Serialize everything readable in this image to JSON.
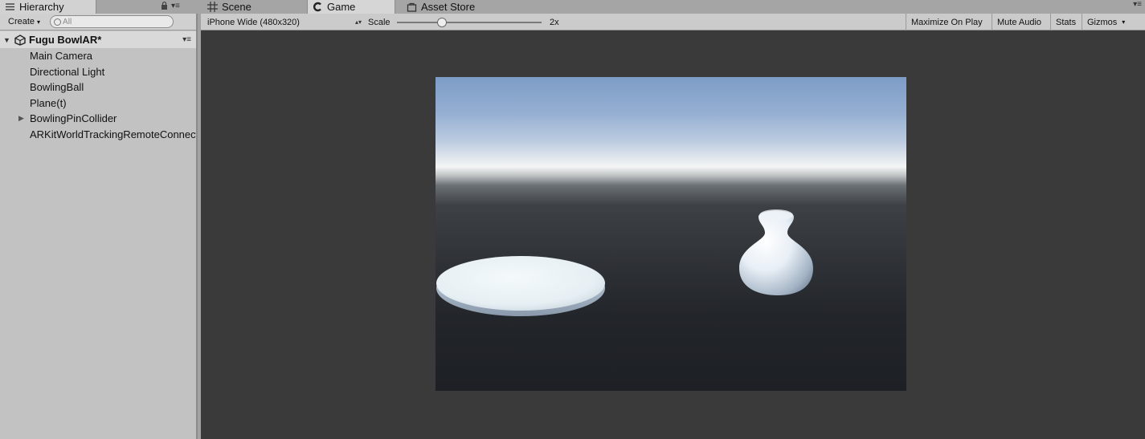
{
  "tabs": {
    "hierarchy": "Hierarchy",
    "scene": "Scene",
    "game": "Game",
    "asset_store": "Asset Store"
  },
  "hierarchy": {
    "create_label": "Create",
    "search_placeholder": "All",
    "scene_name": "Fugu BowlAR*",
    "items": [
      {
        "label": "Main Camera",
        "expandable": false
      },
      {
        "label": "Directional Light",
        "expandable": false
      },
      {
        "label": "BowlingBall",
        "expandable": false
      },
      {
        "label": "Plane(t)",
        "expandable": false
      },
      {
        "label": "BowlingPinCollider",
        "expandable": true
      },
      {
        "label": "ARKitWorldTrackingRemoteConnection",
        "expandable": false
      }
    ]
  },
  "game_toolbar": {
    "resolution": "iPhone Wide (480x320)",
    "scale_label": "Scale",
    "scale_value": "2x",
    "maximize_on_play": "Maximize On Play",
    "mute_audio": "Mute Audio",
    "stats": "Stats",
    "gizmos": "Gizmos"
  },
  "colors": {
    "editor_bg": "#a2a2a2",
    "game_bg": "#3a3a3a",
    "sky_top": "#7d9cc6",
    "horizon": "#f4f5f4",
    "ground": "#1d2025"
  }
}
